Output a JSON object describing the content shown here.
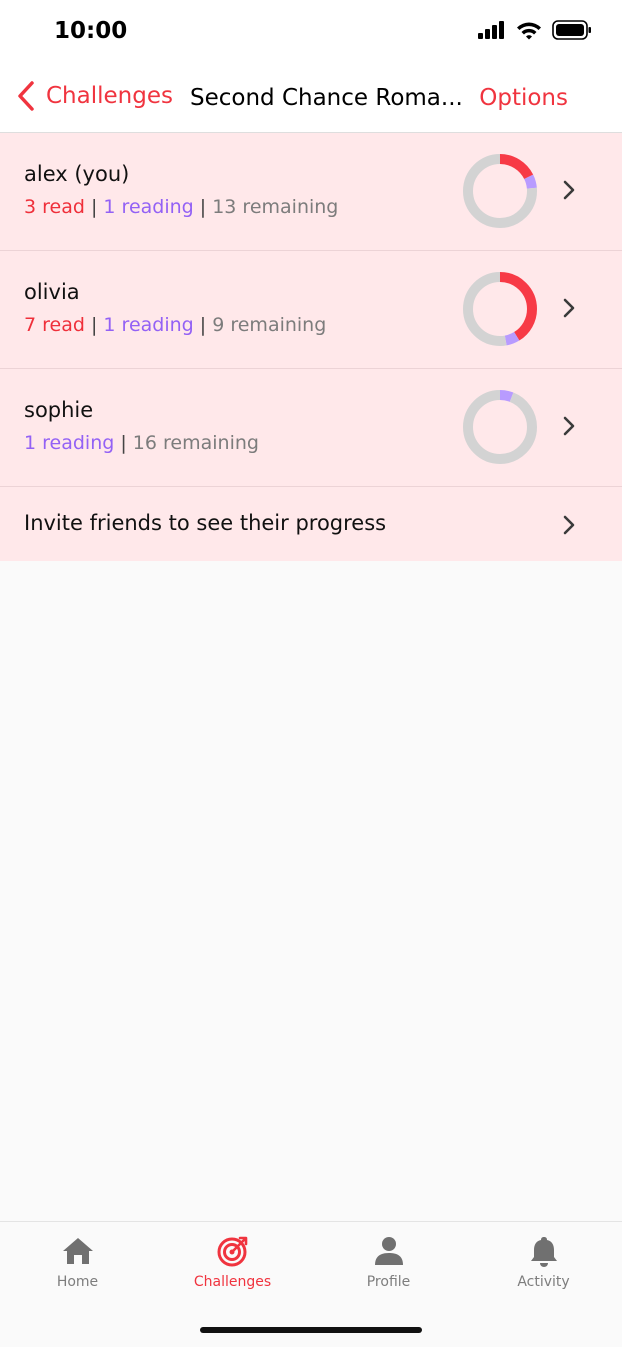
{
  "status_bar": {
    "time": "10:00"
  },
  "nav": {
    "back_label": "Challenges",
    "title": "Second Chance Roma...",
    "options_label": "Options"
  },
  "colors": {
    "accent": "#f0343f",
    "read": "#f73a46",
    "reading": "#b89bff",
    "remaining": "#d3d3d3",
    "row_bg": "#ffe8ea"
  },
  "members": [
    {
      "name": "alex (you)",
      "read": 3,
      "reading": 1,
      "remaining": 13,
      "read_text": "3 read",
      "reading_text": "1 reading",
      "remaining_text": "13 remaining"
    },
    {
      "name": "olivia",
      "read": 7,
      "reading": 1,
      "remaining": 9,
      "read_text": "7 read",
      "reading_text": "1 reading",
      "remaining_text": "9 remaining"
    },
    {
      "name": "sophie",
      "read": 0,
      "reading": 1,
      "remaining": 16,
      "read_text": "",
      "reading_text": "1 reading",
      "remaining_text": "16 remaining"
    }
  ],
  "invite": {
    "label": "Invite friends to see their progress"
  },
  "tabs": [
    {
      "label": "Home",
      "icon": "home-icon",
      "active": false
    },
    {
      "label": "Challenges",
      "icon": "target-icon",
      "active": true
    },
    {
      "label": "Profile",
      "icon": "person-icon",
      "active": false
    },
    {
      "label": "Activity",
      "icon": "bell-icon",
      "active": false
    }
  ]
}
